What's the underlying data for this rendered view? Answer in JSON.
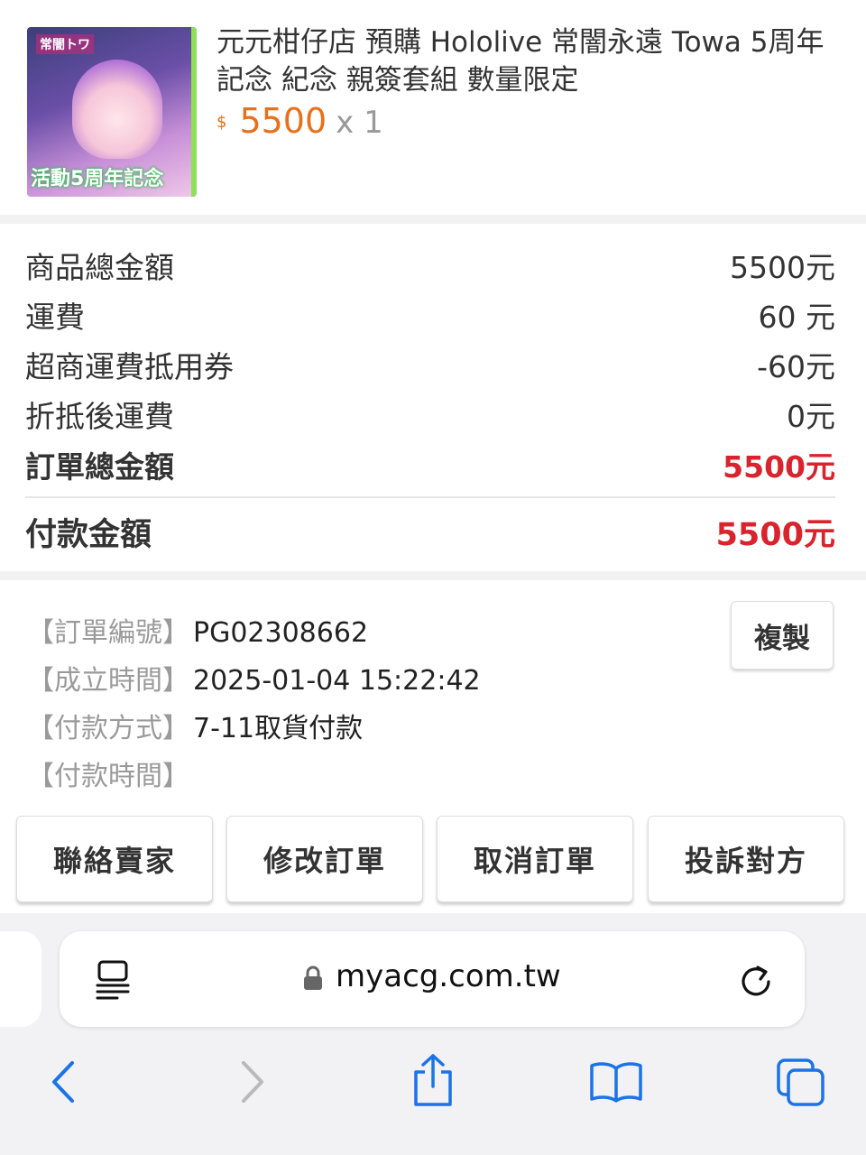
{
  "order_item": {
    "title": "元元柑仔店 預購 Hololive 常闇永遠 Towa 5周年記念 紀念 親簽套組 數量限定",
    "currency_symbol": "$",
    "price": "5500",
    "quantity": "x 1",
    "thumb_logo": "常闇トワ",
    "thumb_caption": "活動5周年記念"
  },
  "summary": {
    "rows": [
      {
        "label": "商品總金額",
        "value": "5500元"
      },
      {
        "label": "運費",
        "value": "60 元"
      },
      {
        "label": "超商運費抵用券",
        "value": "-60元"
      },
      {
        "label": "折抵後運費",
        "value": "0元"
      },
      {
        "label": "訂單總金額",
        "value": "5500元"
      }
    ],
    "payment_label": "付款金額",
    "payment_value": "5500元"
  },
  "order_info": {
    "order_no_label": "【訂單編號】",
    "order_no": "PG02308662",
    "created_label": "【成立時間】",
    "created": "2025-01-04 15:22:42",
    "pay_method_label": "【付款方式】",
    "pay_method": "7-11取貨付款",
    "pay_time_label": "【付款時間】",
    "copy_label": "複製"
  },
  "actions": [
    "聯絡賣家",
    "修改訂單",
    "取消訂單",
    "投訴對方"
  ],
  "browser": {
    "url": "myacg.com.tw",
    "icons": [
      "reader-icon",
      "lock-icon",
      "reload-icon",
      "back-icon",
      "forward-icon",
      "share-icon",
      "bookmarks-icon",
      "tabs-icon"
    ]
  },
  "colors": {
    "price_orange": "#e8701a",
    "total_red": "#d9232d",
    "ios_blue": "#1a73e8"
  }
}
